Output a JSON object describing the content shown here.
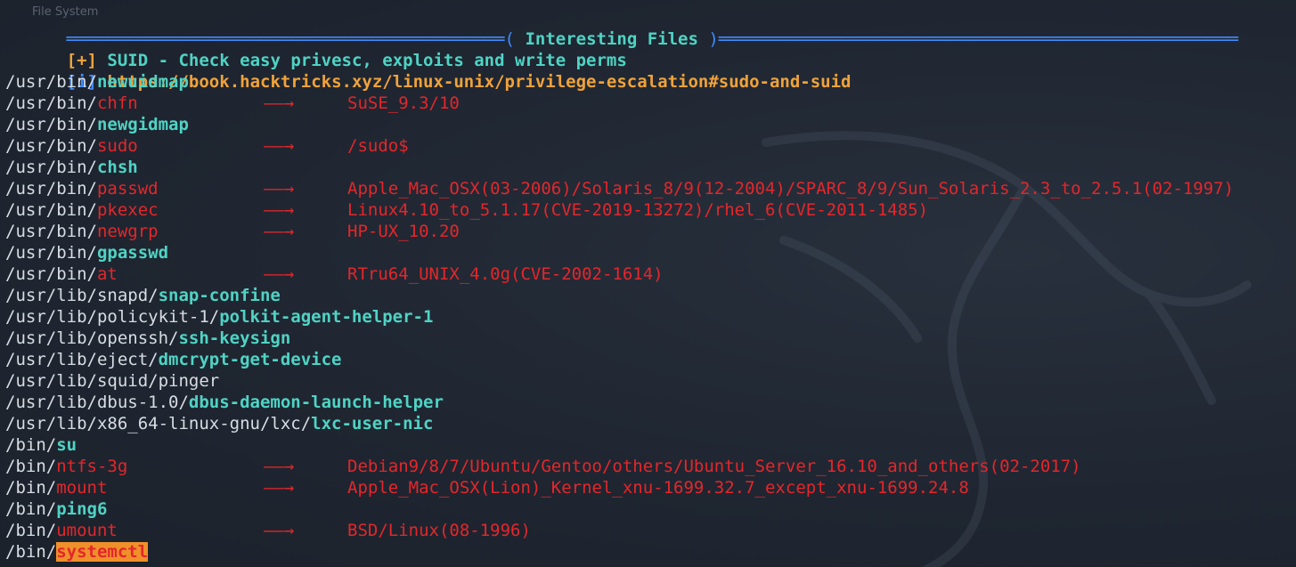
{
  "window": {
    "ghost_title": "File System"
  },
  "banner": {
    "left_rule": "═══════════════════════════════════════════",
    "open_paren": "(",
    "title": "Interesting Files",
    "close_paren": ")",
    "right_rule": "═══════════════════════════════════════════════════"
  },
  "info": {
    "suid_tag": "[+]",
    "suid_text": "SUID - Check easy privesc, exploits and write perms",
    "link_tag": "[i]",
    "link_text": "https://book.hacktricks.xyz/linux-unix/privilege-escalation#sudo-and-suid"
  },
  "arrow_symbol": "——→",
  "suid_files": [
    {
      "dir": "/usr/bin/",
      "name": "newuidmap",
      "status": "ok",
      "exploit": ""
    },
    {
      "dir": "/usr/bin/",
      "name": "chfn",
      "status": "vuln",
      "exploit": "SuSE_9.3/10"
    },
    {
      "dir": "/usr/bin/",
      "name": "newgidmap",
      "status": "ok",
      "exploit": ""
    },
    {
      "dir": "/usr/bin/",
      "name": "sudo",
      "status": "vuln",
      "exploit": "/sudo$"
    },
    {
      "dir": "/usr/bin/",
      "name": "chsh",
      "status": "ok",
      "exploit": ""
    },
    {
      "dir": "/usr/bin/",
      "name": "passwd",
      "status": "vuln",
      "exploit": "Apple_Mac_OSX(03-2006)/Solaris_8/9(12-2004)/SPARC_8/9/Sun_Solaris_2.3_to_2.5.1(02-1997)"
    },
    {
      "dir": "/usr/bin/",
      "name": "pkexec",
      "status": "vuln",
      "exploit": "Linux4.10_to_5.1.17(CVE-2019-13272)/rhel_6(CVE-2011-1485)"
    },
    {
      "dir": "/usr/bin/",
      "name": "newgrp",
      "status": "vuln",
      "exploit": "HP-UX_10.20"
    },
    {
      "dir": "/usr/bin/",
      "name": "gpasswd",
      "status": "ok",
      "exploit": ""
    },
    {
      "dir": "/usr/bin/",
      "name": "at",
      "status": "vuln",
      "exploit": "RTru64_UNIX_4.0g(CVE-2002-1614)"
    },
    {
      "dir": "/usr/lib/snapd/",
      "name": "snap-confine",
      "status": "ok",
      "exploit": ""
    },
    {
      "dir": "/usr/lib/policykit-1/",
      "name": "polkit-agent-helper-1",
      "status": "ok",
      "exploit": ""
    },
    {
      "dir": "/usr/lib/openssh/",
      "name": "ssh-keysign",
      "status": "ok",
      "exploit": ""
    },
    {
      "dir": "/usr/lib/eject/",
      "name": "dmcrypt-get-device",
      "status": "ok",
      "exploit": ""
    },
    {
      "dir": "/usr/lib/squid/pinger",
      "name": "",
      "status": "plain",
      "exploit": ""
    },
    {
      "dir": "/usr/lib/dbus-1.0/",
      "name": "dbus-daemon-launch-helper",
      "status": "ok",
      "exploit": ""
    },
    {
      "dir": "/usr/lib/x86_64-linux-gnu/lxc/",
      "name": "lxc-user-nic",
      "status": "ok",
      "exploit": ""
    },
    {
      "dir": "/bin/",
      "name": "su",
      "status": "ok",
      "exploit": ""
    },
    {
      "dir": "/bin/",
      "name": "ntfs-3g",
      "status": "vuln",
      "exploit": "Debian9/8/7/Ubuntu/Gentoo/others/Ubuntu_Server_16.10_and_others(02-2017)"
    },
    {
      "dir": "/bin/",
      "name": "mount",
      "status": "vuln",
      "exploit": "Apple_Mac_OSX(Lion)_Kernel_xnu-1699.32.7_except_xnu-1699.24.8"
    },
    {
      "dir": "/bin/",
      "name": "ping6",
      "status": "ok",
      "exploit": ""
    },
    {
      "dir": "/bin/",
      "name": "umount",
      "status": "vuln",
      "exploit": "BSD/Linux(08-1996)"
    },
    {
      "dir": "/bin/",
      "name": "systemctl",
      "status": "highlight",
      "exploit": ""
    }
  ],
  "colors": {
    "background": "#1f2631",
    "path": "#d8dce3",
    "safe_binary": "#4fd3c4",
    "vulnerable": "#e3272b",
    "highlight_bg": "#f0902b",
    "rule": "#3f8cff",
    "link": "#f0a23a"
  },
  "icons": {
    "watermark": "kali-dragon-icon"
  }
}
